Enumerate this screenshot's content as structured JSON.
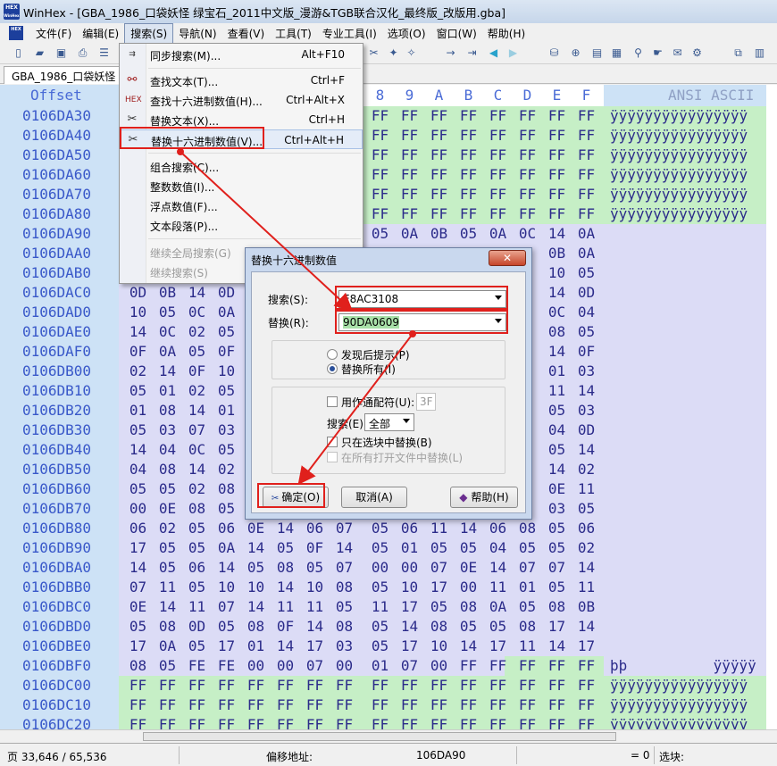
{
  "window": {
    "title": "WinHex - [GBA_1986_口袋妖怪 绿宝石_2011中文版_漫游&TGB联合汉化_最终版_改版用.gba]",
    "logo_top": "HEX",
    "logo_bottom": "WinHex"
  },
  "menubar": {
    "items": [
      "文件(F)",
      "编辑(E)",
      "搜索(S)",
      "导航(N)",
      "查看(V)",
      "工具(T)",
      "专业工具(I)",
      "选项(O)",
      "窗口(W)",
      "帮助(H)"
    ],
    "active_index": 2
  },
  "tab": {
    "label": "GBA_1986_口袋妖怪 绿"
  },
  "hex": {
    "offset_header": "Offset",
    "ansi_header": "ANSI ASCII",
    "visible_columns": [
      "8",
      "9",
      "A",
      "B",
      "C",
      "D",
      "E",
      "F"
    ],
    "rows": [
      {
        "off": "0106DA30",
        "left": "",
        "right": [
          "FF",
          "FF",
          "FF",
          "FF",
          "FF",
          "FF",
          "FF",
          "FF"
        ],
        "ansi": "ÿÿÿÿÿÿÿÿÿÿÿÿÿÿÿÿ"
      },
      {
        "off": "0106DA40",
        "left": "",
        "right": [
          "FF",
          "FF",
          "FF",
          "FF",
          "FF",
          "FF",
          "FF",
          "FF"
        ],
        "ansi": "ÿÿÿÿÿÿÿÿÿÿÿÿÿÿÿÿ"
      },
      {
        "off": "0106DA50",
        "left": "",
        "right": [
          "FF",
          "FF",
          "FF",
          "FF",
          "FF",
          "FF",
          "FF",
          "FF"
        ],
        "ansi": "ÿÿÿÿÿÿÿÿÿÿÿÿÿÿÿÿ"
      },
      {
        "off": "0106DA60",
        "left": "",
        "right": [
          "FF",
          "FF",
          "FF",
          "FF",
          "FF",
          "FF",
          "FF",
          "FF"
        ],
        "ansi": "ÿÿÿÿÿÿÿÿÿÿÿÿÿÿÿÿ"
      },
      {
        "off": "0106DA70",
        "left": "",
        "right": [
          "FF",
          "FF",
          "FF",
          "FF",
          "FF",
          "FF",
          "FF",
          "FF"
        ],
        "ansi": "ÿÿÿÿÿÿÿÿÿÿÿÿÿÿÿÿ"
      },
      {
        "off": "0106DA80",
        "left": "",
        "right": [
          "FF",
          "FF",
          "FF",
          "FF",
          "FF",
          "FF",
          "FF",
          "FF"
        ],
        "ansi": "ÿÿÿÿÿÿÿÿÿÿÿÿÿÿÿÿ"
      },
      {
        "off": "0106DA90",
        "left": "",
        "right": [
          "05",
          "0A",
          "0B",
          "05",
          "0A",
          "0C",
          "14",
          "0A"
        ],
        "ansi": ""
      },
      {
        "off": "0106DAA0",
        "left": "",
        "right": [
          "",
          "",
          "",
          "",
          "",
          "",
          "0B",
          "0A"
        ],
        "ansi": ""
      },
      {
        "off": "0106DAB0",
        "left": "",
        "right": [
          "",
          "",
          "",
          "",
          "",
          "",
          "10",
          "05"
        ],
        "ansi": ""
      },
      {
        "off": "0106DAC0",
        "left": "0D 0B 14 0D",
        "right": [
          "",
          "",
          "",
          "",
          "",
          "",
          "14",
          "0D"
        ],
        "ansi": ""
      },
      {
        "off": "0106DAD0",
        "left": "10 05 0C 0A",
        "right": [
          "",
          "",
          "",
          "",
          "",
          "",
          "0C",
          "04"
        ],
        "ansi": ""
      },
      {
        "off": "0106DAE0",
        "left": "14 0C 02 05",
        "right": [
          "",
          "",
          "",
          "",
          "",
          "",
          "08",
          "05"
        ],
        "ansi": ""
      },
      {
        "off": "0106DAF0",
        "left": "0F 0A 05 0F",
        "right": [
          "",
          "",
          "",
          "",
          "",
          "",
          "14",
          "0F"
        ],
        "ansi": ""
      },
      {
        "off": "0106DB00",
        "left": "02 14 0F 10",
        "right": [
          "",
          "",
          "",
          "",
          "",
          "",
          "01",
          "03"
        ],
        "ansi": ""
      },
      {
        "off": "0106DB10",
        "left": "05 01 02 05",
        "right": [
          "",
          "",
          "",
          "",
          "",
          "",
          "11",
          "14"
        ],
        "ansi": ""
      },
      {
        "off": "0106DB20",
        "left": "01 08 14 01",
        "right": [
          "",
          "",
          "",
          "",
          "",
          "",
          "05",
          "03"
        ],
        "ansi": ""
      },
      {
        "off": "0106DB30",
        "left": "05 03 07 03",
        "right": [
          "",
          "",
          "",
          "",
          "",
          "",
          "04",
          "0D"
        ],
        "ansi": ""
      },
      {
        "off": "0106DB40",
        "left": "14 04 0C 05",
        "right": [
          "",
          "",
          "",
          "",
          "",
          "",
          "05",
          "14"
        ],
        "ansi": ""
      },
      {
        "off": "0106DB50",
        "left": "04 08 14 02",
        "right": [
          "",
          "",
          "",
          "",
          "",
          "",
          "14",
          "02"
        ],
        "ansi": ""
      },
      {
        "off": "0106DB60",
        "left": "05 05 02 08",
        "right": [
          "",
          "",
          "",
          "",
          "",
          "",
          "0E",
          "11"
        ],
        "ansi": ""
      },
      {
        "off": "0106DB70",
        "left": "00 0E 08 05",
        "right": [
          "",
          "",
          "",
          "",
          "",
          "",
          "03",
          "05"
        ],
        "ansi": ""
      },
      {
        "off": "0106DB80",
        "left": "06 02 05 06 0E 14 06 07",
        "right": [
          "05",
          "06",
          "11",
          "14",
          "06",
          "08",
          "05",
          "06"
        ],
        "ansi": ""
      },
      {
        "off": "0106DB90",
        "left": "17 05 05 0A 14 05 0F 14",
        "right": [
          "05",
          "01",
          "05",
          "05",
          "04",
          "05",
          "05",
          "02"
        ],
        "ansi": ""
      },
      {
        "off": "0106DBA0",
        "left": "14 05 06 14 05 08 05 07",
        "right": [
          "00",
          "00",
          "07",
          "0E",
          "14",
          "07",
          "07",
          "14"
        ],
        "ansi": ""
      },
      {
        "off": "0106DBB0",
        "left": "07 11 05 10 10 14 10 08",
        "right": [
          "05",
          "10",
          "17",
          "00",
          "11",
          "01",
          "05",
          "11"
        ],
        "ansi": ""
      },
      {
        "off": "0106DBC0",
        "left": "0E 14 11 07 14 11 11 05",
        "right": [
          "11",
          "17",
          "05",
          "08",
          "0A",
          "05",
          "08",
          "0B"
        ],
        "ansi": ""
      },
      {
        "off": "0106DBD0",
        "left": "05 08 0D 05 08 0F 14 08",
        "right": [
          "05",
          "14",
          "08",
          "05",
          "05",
          "08",
          "17",
          "14"
        ],
        "ansi": ""
      },
      {
        "off": "0106DBE0",
        "left": "17 0A 05 17 01 14 17 03",
        "right": [
          "05",
          "17",
          "10",
          "14",
          "17",
          "11",
          "14",
          "17"
        ],
        "ansi": ""
      },
      {
        "off": "0106DBF0",
        "left": "08 05 FE FE 00 00 07 00",
        "right": [
          "01",
          "07",
          "00",
          "FF",
          "FF",
          "FF",
          "FF",
          "FF"
        ],
        "ansi": "þþ          ÿÿÿÿÿ"
      },
      {
        "off": "0106DC00",
        "left": "FF FF FF FF FF FF FF FF",
        "right": [
          "FF",
          "FF",
          "FF",
          "FF",
          "FF",
          "FF",
          "FF",
          "FF"
        ],
        "ansi": "ÿÿÿÿÿÿÿÿÿÿÿÿÿÿÿÿ"
      },
      {
        "off": "0106DC10",
        "left": "FF FF FF FF FF FF FF FF",
        "right": [
          "FF",
          "FF",
          "FF",
          "FF",
          "FF",
          "FF",
          "FF",
          "FF"
        ],
        "ansi": "ÿÿÿÿÿÿÿÿÿÿÿÿÿÿÿÿ"
      },
      {
        "off": "0106DC20",
        "left": "FF FF FF FF FF FF FF FF",
        "right": [
          "FF",
          "FF",
          "FF",
          "FF",
          "FF",
          "FF",
          "FF",
          "FF"
        ],
        "ansi": "ÿÿÿÿÿÿÿÿÿÿÿÿÿÿÿÿ"
      }
    ]
  },
  "search_menu": {
    "items": [
      {
        "label": "同步搜索(M)...",
        "shortcut": "Alt+F10",
        "icon": "sync-search-icon",
        "disabled": false
      },
      {
        "label": "查找文本(T)...",
        "shortcut": "Ctrl+F",
        "icon": "binoculars-icon",
        "disabled": false
      },
      {
        "label": "查找十六进制数值(H)...",
        "shortcut": "Ctrl+Alt+X",
        "icon": "hex-search-icon",
        "disabled": false
      },
      {
        "label": "替换文本(X)...",
        "shortcut": "Ctrl+H",
        "icon": "replace-text-icon",
        "disabled": false
      },
      {
        "label": "替换十六进制数值(V)...",
        "shortcut": "Ctrl+Alt+H",
        "icon": "hex-replace-icon",
        "disabled": false
      },
      {
        "label": "组合搜索(C)...",
        "shortcut": "",
        "icon": "",
        "disabled": false
      },
      {
        "label": "整数数值(I)...",
        "shortcut": "",
        "icon": "",
        "disabled": false
      },
      {
        "label": "浮点数值(F)...",
        "shortcut": "",
        "icon": "",
        "disabled": false
      },
      {
        "label": "文本段落(P)...",
        "shortcut": "",
        "icon": "",
        "disabled": false
      },
      {
        "label": "继续全局搜索(G)",
        "shortcut": "",
        "icon": "",
        "disabled": true
      },
      {
        "label": "继续搜索(S)",
        "shortcut": "",
        "icon": "",
        "disabled": true
      }
    ]
  },
  "dialog": {
    "title": "替换十六进制数值",
    "search_label": "搜索(S):",
    "search_value": "E8AC3108",
    "replace_label": "替换(R):",
    "replace_value": "90DA0609",
    "radio_prompt": "发现后提示(P)",
    "radio_replace_all": "替换所有(I)",
    "wildcard_label": "用作通配符(U):",
    "wildcard_value": "3F",
    "search_dir_label": "搜索(E):",
    "search_dir_value": "全部",
    "only_selection": "只在选块中替换(B)",
    "all_files": "在所有打开文件中替换(L)",
    "ok": "确定(O)",
    "cancel": "取消(A)",
    "help": "帮助(H)"
  },
  "status": {
    "page": "页 33,646 / 65,536",
    "offset_label": "偏移地址:",
    "offset_value": "106DA90",
    "equals": "= 0",
    "selection": "选块:"
  },
  "colors": {
    "annotation": "#e0201c",
    "offset_bg": "#cde2f6",
    "data_bg": "#c6efc6",
    "ansi_bg": "#dcdcf6"
  }
}
